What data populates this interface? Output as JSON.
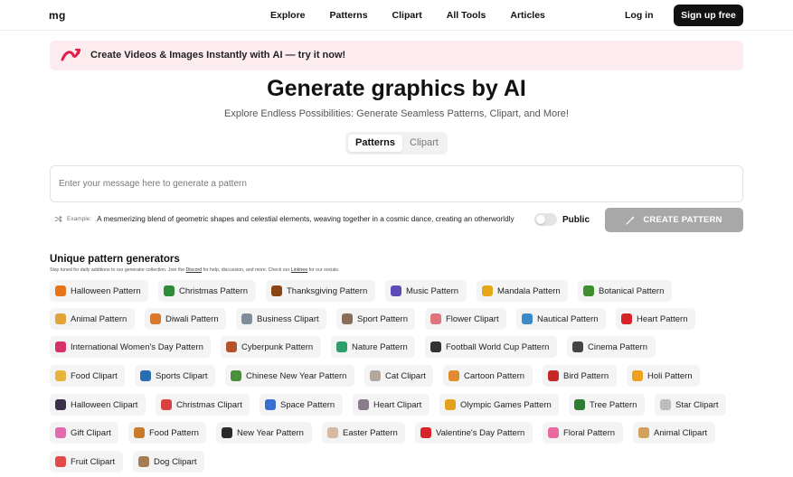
{
  "nav": {
    "logo": "mg",
    "links": [
      "Explore",
      "Patterns",
      "Clipart",
      "All Tools",
      "Articles"
    ],
    "login": "Log in",
    "signup": "Sign up free"
  },
  "banner": {
    "text": "Create Videos & Images Instantly with ",
    "highlight": "AI — try it now!"
  },
  "hero": {
    "title": "Generate graphics by AI",
    "subtitle": "Explore Endless Possibilities: Generate Seamless Patterns, Clipart, and More!"
  },
  "tabs": [
    "Patterns",
    "Clipart"
  ],
  "prompt": {
    "placeholder": "Enter your message here to generate a pattern",
    "value": ""
  },
  "example": {
    "label": "Example:",
    "text": "A mesmerizing blend of geometric shapes and celestial elements, weaving together in a cosmic dance, creating an otherworldly"
  },
  "public_label": "Public",
  "create_button": "CREATE PATTERN",
  "section": {
    "title": "Unique pattern generators",
    "note_before": "Stay tuned for daily additions to our generator collection. Join the ",
    "discord": "Discord",
    "note_middle": " for help, discussion, and more. Check our ",
    "linktree": "Linktree",
    "note_after": " for our socials."
  },
  "colors": {
    "banner_bg": "#fdecef",
    "accent": "#e11d48",
    "create_button_bg": "#a8a8a8"
  },
  "generators": [
    [
      {
        "label": "Halloween Pattern",
        "icon": "pumpkin-icon",
        "color": "#e8741a"
      },
      {
        "label": "Christmas Pattern",
        "icon": "tree-icon",
        "color": "#2e8b3a"
      },
      {
        "label": "Thanksgiving Pattern",
        "icon": "turkey-icon",
        "color": "#8b4513"
      },
      {
        "label": "Music Pattern",
        "icon": "music-icon",
        "color": "#5b4bb7"
      },
      {
        "label": "Mandala Pattern",
        "icon": "mandala-icon",
        "color": "#e6a817"
      },
      {
        "label": "Botanical Pattern",
        "icon": "leaf-icon",
        "color": "#3f8f2f"
      }
    ],
    [
      {
        "label": "Animal Pattern",
        "icon": "lion-icon",
        "color": "#e2a33a"
      },
      {
        "label": "Diwali Pattern",
        "icon": "lamp-icon",
        "color": "#d9772b"
      },
      {
        "label": "Business Clipart",
        "icon": "business-icon",
        "color": "#7f8c9a"
      },
      {
        "label": "Sport Pattern",
        "icon": "stadium-icon",
        "color": "#8a6d5a"
      },
      {
        "label": "Flower Clipart",
        "icon": "flower-icon",
        "color": "#e0737c"
      },
      {
        "label": "Nautical Pattern",
        "icon": "wave-icon",
        "color": "#3a89c9"
      },
      {
        "label": "Heart Pattern",
        "icon": "heart-icon",
        "color": "#d8232a"
      }
    ],
    [
      {
        "label": "International Women's Day Pattern",
        "icon": "tulip-icon",
        "color": "#d6336c"
      },
      {
        "label": "Cyberpunk Pattern",
        "icon": "city-icon",
        "color": "#b4532a"
      },
      {
        "label": "Nature Pattern",
        "icon": "mountain-icon",
        "color": "#2f9e6f"
      },
      {
        "label": "Football World Cup Pattern",
        "icon": "soccer-ball-icon",
        "color": "#333333"
      },
      {
        "label": "Cinema Pattern",
        "icon": "film-icon",
        "color": "#444444"
      }
    ],
    [
      {
        "label": "Food Clipart",
        "icon": "food-icon",
        "color": "#e7b33b"
      },
      {
        "label": "Sports Clipart",
        "icon": "athlete-icon",
        "color": "#2b6cb0"
      },
      {
        "label": "Chinese New Year Pattern",
        "icon": "dragon-icon",
        "color": "#4a8f3a"
      },
      {
        "label": "Cat Clipart",
        "icon": "cat-icon",
        "color": "#b5a89a"
      },
      {
        "label": "Cartoon Pattern",
        "icon": "pencil-icon",
        "color": "#e08b2e"
      },
      {
        "label": "Bird Pattern",
        "icon": "bird-icon",
        "color": "#c62828"
      },
      {
        "label": "Holi Pattern",
        "icon": "color-powder-icon",
        "color": "#f0a020"
      }
    ],
    [
      {
        "label": "Halloween Clipart",
        "icon": "witch-icon",
        "color": "#3b2f4a"
      },
      {
        "label": "Christmas Clipart",
        "icon": "santa-icon",
        "color": "#d94343"
      },
      {
        "label": "Space Pattern",
        "icon": "rocket-icon",
        "color": "#3c6fd1"
      },
      {
        "label": "Heart Clipart",
        "icon": "heart-box-icon",
        "color": "#8c7b8f"
      },
      {
        "label": "Olympic Games Pattern",
        "icon": "medal-icon",
        "color": "#e0a21b"
      },
      {
        "label": "Tree Pattern",
        "icon": "pine-tree-icon",
        "color": "#2e7d32"
      },
      {
        "label": "Star Clipart",
        "icon": "star-icon",
        "color": "#bdbdbd"
      }
    ],
    [
      {
        "label": "Gift Clipart",
        "icon": "gift-icon",
        "color": "#e06bb0"
      },
      {
        "label": "Food Pattern",
        "icon": "burger-icon",
        "color": "#c87b2a"
      },
      {
        "label": "New Year Pattern",
        "icon": "party-icon",
        "color": "#2b2b2b"
      },
      {
        "label": "Easter Pattern",
        "icon": "egg-icon",
        "color": "#d9b9a0"
      },
      {
        "label": "Valentine's Day Pattern",
        "icon": "heart-icon",
        "color": "#d8232a"
      },
      {
        "label": "Floral Pattern",
        "icon": "blossom-icon",
        "color": "#e86aa0"
      },
      {
        "label": "Animal Clipart",
        "icon": "animal-icon",
        "color": "#d2a15c"
      }
    ],
    [
      {
        "label": "Fruit Clipart",
        "icon": "fruit-icon",
        "color": "#e24a4a"
      },
      {
        "label": "Dog Clipart",
        "icon": "dog-icon",
        "color": "#a67c52"
      }
    ]
  ]
}
